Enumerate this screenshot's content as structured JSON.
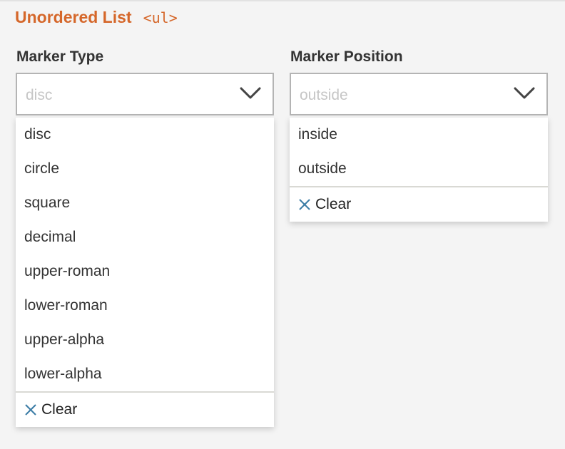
{
  "section": {
    "title": "Unordered List",
    "tag": "<ul>"
  },
  "marker_type": {
    "label": "Marker Type",
    "placeholder": "disc",
    "options": [
      "disc",
      "circle",
      "square",
      "decimal",
      "upper-roman",
      "lower-roman",
      "upper-alpha",
      "lower-alpha"
    ],
    "clear_label": "Clear"
  },
  "marker_position": {
    "label": "Marker Position",
    "placeholder": "outside",
    "options": [
      "inside",
      "outside"
    ],
    "clear_label": "Clear"
  },
  "colors": {
    "accent": "#d5672a",
    "clear_icon": "#3a7ca5",
    "text": "#333333",
    "placeholder": "#c6c6c6"
  },
  "icons": {
    "select_chevron": "chevron-down-icon",
    "clear": "close-icon"
  }
}
